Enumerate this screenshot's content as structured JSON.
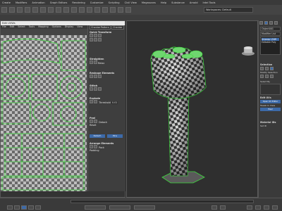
{
  "menubar": {
    "items": [
      "Create",
      "Modifiers",
      "Animation",
      "Graph Editors",
      "Rendering",
      "Customize",
      "Scripting",
      "Civil View",
      "Megascans",
      "Help",
      "Substance",
      "Arnold",
      "Intel Tools"
    ]
  },
  "toolbar": {
    "workspace": "Workspaces: Default"
  },
  "uv_editor": {
    "title": "Edit UVWs",
    "menu": [
      "File",
      "Edit",
      "Select",
      "Tools",
      "Mapping",
      "Options",
      "Display",
      "View"
    ],
    "panel_tabs": [
      "CheckerPattern",
      "Checker"
    ],
    "sections": {
      "quick_transform": "Quick Transform",
      "reshape": "Reshape Elements",
      "stitch": "Stitch",
      "explode": "Explode",
      "peel": "Peel",
      "arrange": "Arrange Elements",
      "straighten": "Straighten",
      "relax": "Relax",
      "threshold": "Threshold",
      "detach": "Detach",
      "reset": "Reset",
      "padding": "Padding"
    },
    "buttons": {
      "detach_btn": "Detach",
      "pin_btn": "Pins",
      "pack": "Pack"
    },
    "values": {
      "weld": "0.01"
    }
  },
  "command_panel": {
    "object_name": "Object001",
    "modifier_list": "Modifier List",
    "stack": [
      "Unwrap UVW",
      "Editable Poly"
    ],
    "selection": "Selection",
    "modify_selection": "Modify Selection",
    "select_by": "Select By",
    "edit_uvs": "Edit UVs",
    "open_editor": "Open UV Editor",
    "tweak": "Tweak In View",
    "peel_btn": "Peel",
    "material_ids": "Material IDs",
    "set_id": "Set ID"
  },
  "colors": {
    "selection_green": "#3ddc3d",
    "checker_dark": "#3a3a3a",
    "checker_light": "#dcdcdc",
    "accent_blue": "#3d6aa8"
  }
}
